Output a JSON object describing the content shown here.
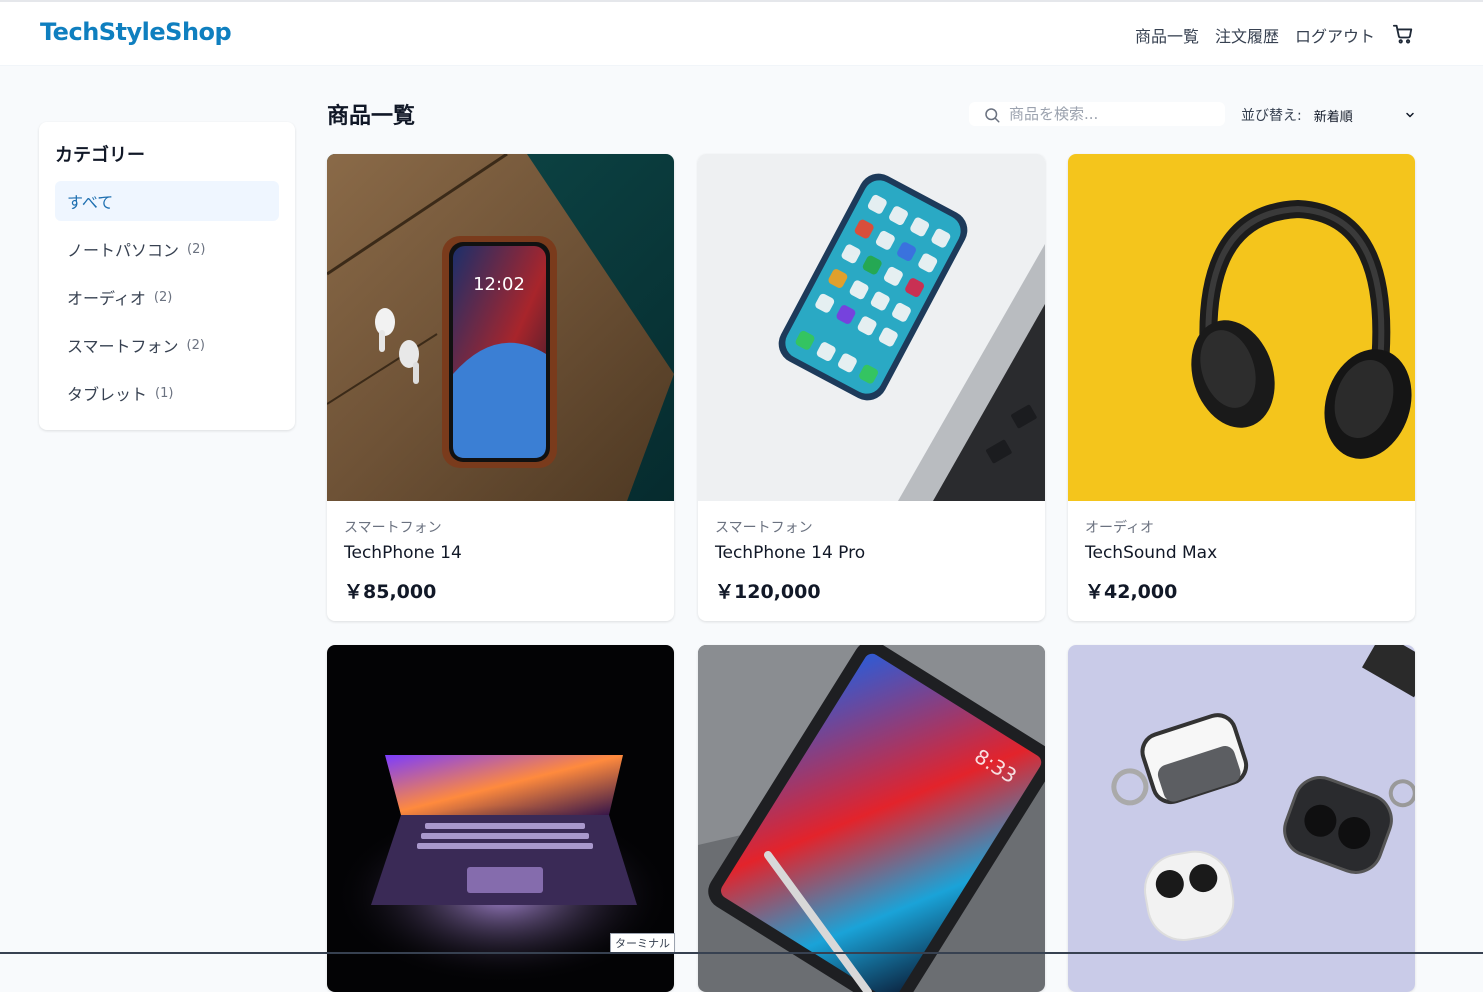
{
  "header": {
    "logo": "TechStyleShop",
    "nav": [
      "商品一覧",
      "注文履歴",
      "ログアウト"
    ]
  },
  "sidebar": {
    "title": "カテゴリー",
    "items": [
      {
        "label": "すべて",
        "count": ""
      },
      {
        "label": "ノートパソコン",
        "count": "(2)"
      },
      {
        "label": "オーディオ",
        "count": "(2)"
      },
      {
        "label": "スマートフォン",
        "count": "(2)"
      },
      {
        "label": "タブレット",
        "count": "(1)"
      }
    ]
  },
  "main": {
    "title": "商品一覧",
    "search_placeholder": "商品を検索...",
    "sort_label": "並び替え:",
    "sort_value": "新着順"
  },
  "products": [
    {
      "category": "スマートフォン",
      "name": "TechPhone 14",
      "price": "￥85,000",
      "image": "smartphone-on-wooden-table"
    },
    {
      "category": "スマートフォン",
      "name": "TechPhone 14 Pro",
      "price": "￥120,000",
      "image": "smartphone-beside-laptop"
    },
    {
      "category": "オーディオ",
      "name": "TechSound Max",
      "price": "￥42,000",
      "image": "black-headphones-on-yellow"
    },
    {
      "category": "",
      "name": "",
      "price": "",
      "image": "laptop-in-dark"
    },
    {
      "category": "",
      "name": "",
      "price": "",
      "image": "tablet-with-stylus"
    },
    {
      "category": "",
      "name": "",
      "price": "",
      "image": "wireless-earbud-cases"
    }
  ],
  "tooltip": "ターミナル",
  "colors": {
    "brand": "#0f7fbf",
    "active_bg": "#eff6ff",
    "background": "#f8fafc"
  }
}
